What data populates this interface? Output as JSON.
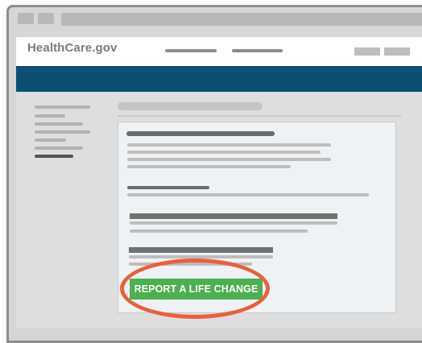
{
  "site": {
    "logo": "HealthCare.gov"
  },
  "card": {
    "cta_label": "REPORT A LIFE CHANGE"
  },
  "colors": {
    "brand_band": "#0b4f73",
    "cta_green": "#4caf50",
    "highlight_ring": "#e8603c"
  }
}
